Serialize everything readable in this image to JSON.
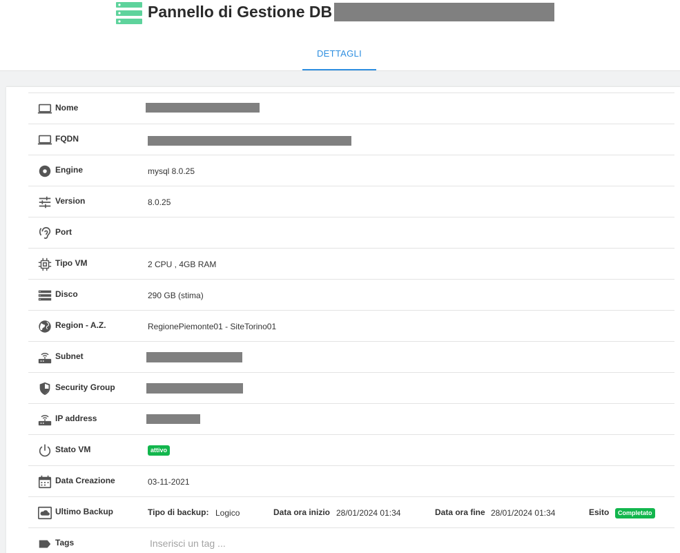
{
  "header": {
    "title": "Pannello di Gestione DB",
    "accent_color": "#5ed39c",
    "logo_icon": "database-server-icon"
  },
  "tabs": [
    {
      "label": "DETTAGLI",
      "active": true,
      "color": "#2d8ee0"
    }
  ],
  "details": {
    "nome": {
      "label": "Nome",
      "icon": "laptop-icon"
    },
    "fqdn": {
      "label": "FQDN",
      "icon": "laptop-icon"
    },
    "engine": {
      "label": "Engine",
      "value": "mysql 8.0.25",
      "icon": "disc-icon"
    },
    "version": {
      "label": "Version",
      "value": "8.0.25",
      "icon": "sliders-icon"
    },
    "port": {
      "label": "Port",
      "value": "",
      "icon": "ear-icon"
    },
    "tipo_vm": {
      "label": "Tipo VM",
      "value": "2 CPU , 4GB RAM",
      "icon": "cpu-chip-icon"
    },
    "disco": {
      "label": "Disco",
      "value": "290 GB (stima)",
      "icon": "storage-icon"
    },
    "region": {
      "label": "Region - A.Z.",
      "value": "RegionePiemonte01 - SiteTorino01",
      "icon": "globe-icon"
    },
    "subnet": {
      "label": "Subnet",
      "icon": "router-icon"
    },
    "security_group": {
      "label": "Security Group",
      "icon": "shield-icon"
    },
    "ip_address": {
      "label": "IP address",
      "icon": "router-icon"
    },
    "stato_vm": {
      "label": "Stato VM",
      "badge": "attivo",
      "badge_color": "#12b64d",
      "icon": "power-icon"
    },
    "data_creazione": {
      "label": "Data Creazione",
      "value": "03-11-2021",
      "icon": "calendar-icon"
    },
    "ultimo_backup": {
      "label": "Ultimo Backup",
      "icon": "cloud-backup-icon",
      "tipo_label": "Tipo di backup:",
      "tipo_value": "Logico",
      "inizio_label": "Data ora inizio",
      "inizio_value": "28/01/2024 01:34",
      "fine_label": "Data ora fine",
      "fine_value": "28/01/2024 01:34",
      "esito_label": "Esito",
      "esito_badge": "Completato"
    },
    "tags": {
      "label": "Tags",
      "placeholder": "Inserisci un tag ...",
      "value": "",
      "icon": "tag-icon"
    }
  }
}
